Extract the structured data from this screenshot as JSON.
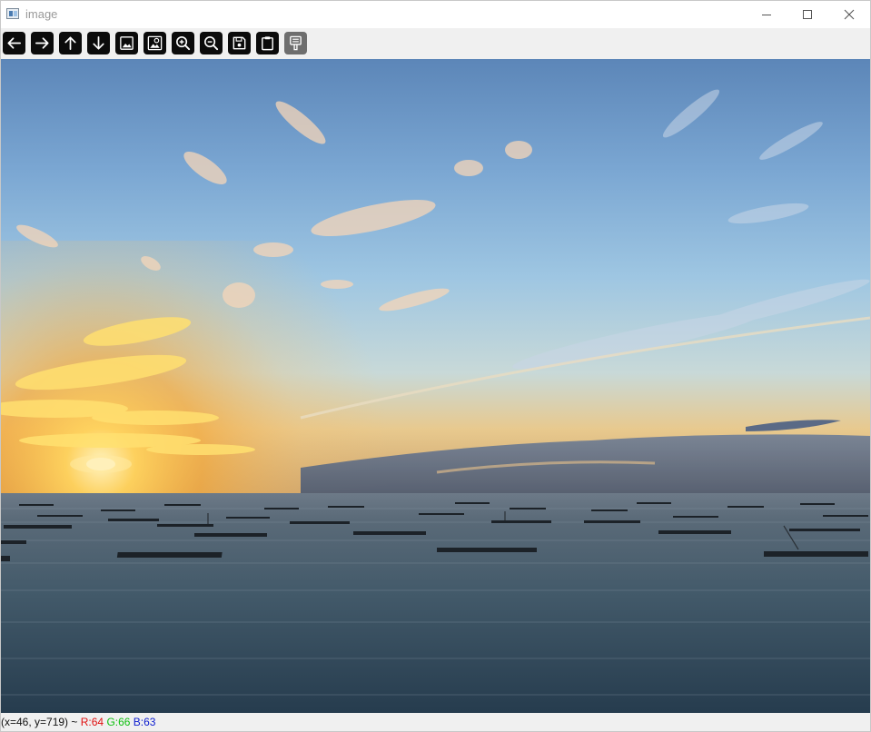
{
  "window": {
    "title": "image",
    "controls": [
      "minimize",
      "maximize",
      "close"
    ]
  },
  "toolbar": {
    "buttons": [
      {
        "icon": "arrow-left-icon",
        "enabled": true
      },
      {
        "icon": "arrow-right-icon",
        "enabled": true
      },
      {
        "icon": "arrow-up-icon",
        "enabled": true
      },
      {
        "icon": "arrow-down-icon",
        "enabled": true
      },
      {
        "icon": "zoom-fit-icon",
        "enabled": true
      },
      {
        "icon": "zoom-original-icon",
        "enabled": true
      },
      {
        "icon": "zoom-in-icon",
        "enabled": true
      },
      {
        "icon": "zoom-out-icon",
        "enabled": true
      },
      {
        "icon": "save-icon",
        "enabled": true
      },
      {
        "icon": "clipboard-icon",
        "enabled": true
      },
      {
        "icon": "properties-icon",
        "enabled": false
      }
    ]
  },
  "image": {
    "description_colors": {
      "sky_top": "#5c86b8",
      "sky_mid": "#9ec6e2",
      "horizon": "#f3a83a",
      "sun": "#fff6c8",
      "sea": "#2e4658"
    }
  },
  "status": {
    "coords": "(x=46, y=719) ~",
    "r": "R:64",
    "g": "G:66",
    "b": "B:63"
  }
}
